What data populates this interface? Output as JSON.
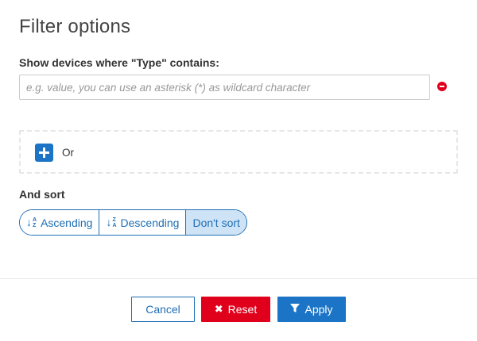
{
  "dialog": {
    "title": "Filter options"
  },
  "filter": {
    "label": "Show devices where \"Type\" contains:",
    "value": "",
    "placeholder": "e.g. value, you can use an asterisk (*) as wildcard character"
  },
  "or_block": {
    "label": "Or"
  },
  "sort": {
    "label": "And sort",
    "options": [
      {
        "label": "Ascending",
        "icon": "sort-ascending-icon",
        "active": false
      },
      {
        "label": "Descending",
        "icon": "sort-descending-icon",
        "active": false
      },
      {
        "label": "Don't sort",
        "icon": null,
        "active": true
      }
    ]
  },
  "footer": {
    "cancel_label": "Cancel",
    "reset_label": "Reset",
    "apply_label": "Apply"
  },
  "colors": {
    "primary": "#1b74c5",
    "danger": "#e0001b",
    "active_bg": "#cfe3f6"
  }
}
